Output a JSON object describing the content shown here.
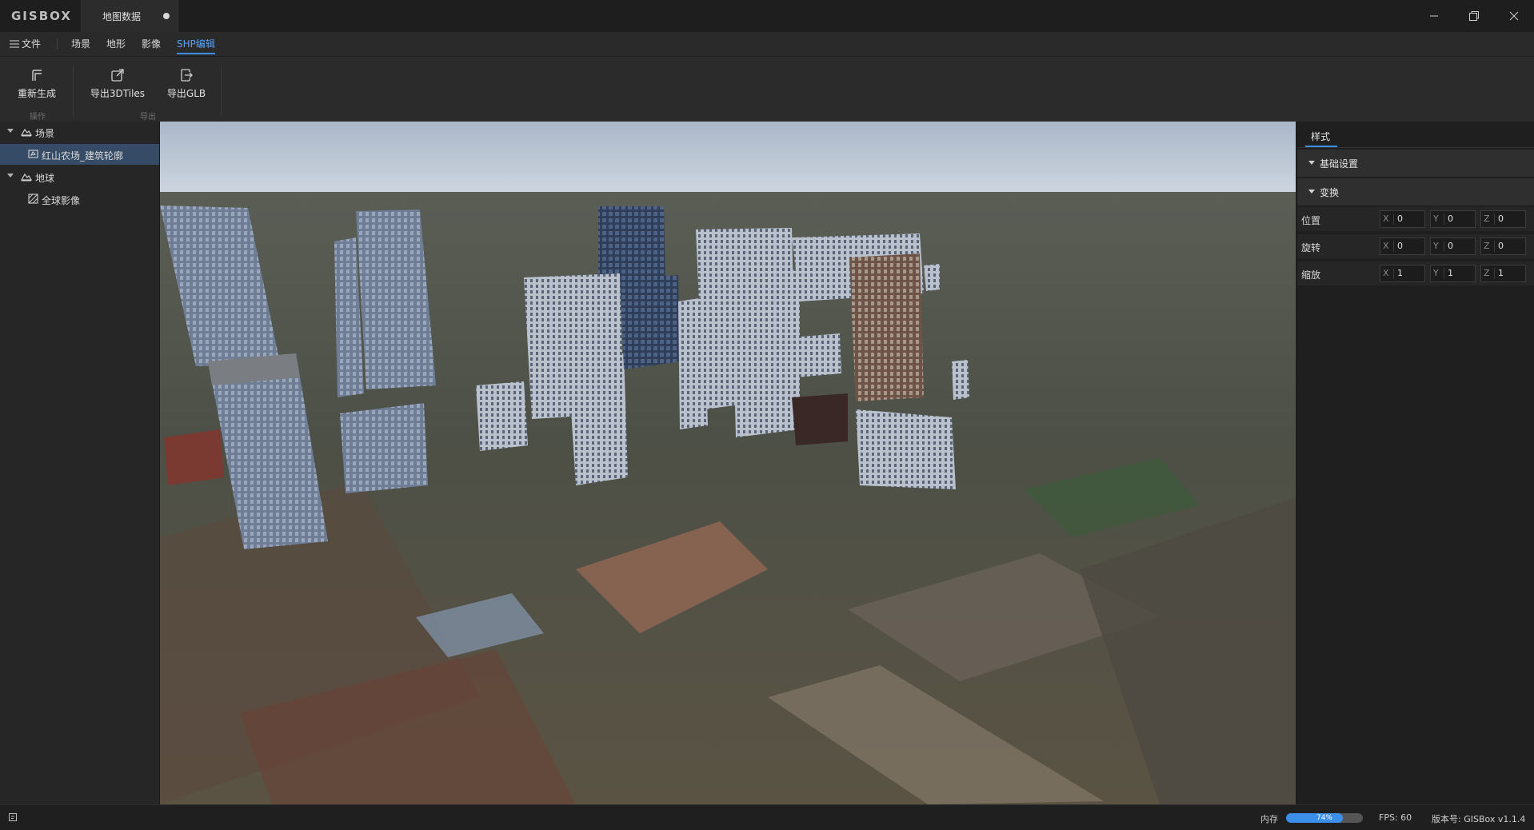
{
  "app": {
    "logo": "GISBOX"
  },
  "document_tab": {
    "title": "地图数据"
  },
  "menubar": {
    "file": "文件",
    "items": [
      {
        "label": "场景"
      },
      {
        "label": "地形"
      },
      {
        "label": "影像"
      },
      {
        "label": "SHP编辑",
        "active": true
      }
    ]
  },
  "ribbon": {
    "regenerate": "重新生成",
    "export_3dtiles": "导出3DTiles",
    "export_glb": "导出GLB",
    "group_ops": "操作",
    "group_export": "导出"
  },
  "tree": {
    "scene_label": "场景",
    "scene_child": "红山农场_建筑轮廓",
    "globe_label": "地球",
    "globe_child": "全球影像"
  },
  "panel": {
    "tab": "样式",
    "basic_settings": "基础设置",
    "transform": "变换",
    "rows": [
      {
        "label": "位置",
        "x": "0",
        "y": "0",
        "z": "0"
      },
      {
        "label": "旋转",
        "x": "0",
        "y": "0",
        "z": "0"
      },
      {
        "label": "缩放",
        "x": "1",
        "y": "1",
        "z": "1"
      }
    ],
    "axis": {
      "x": "X",
      "y": "Y",
      "z": "Z"
    }
  },
  "status": {
    "memory_label": "内存",
    "memory_percent": "74%",
    "memory_fraction": 0.74,
    "fps": "FPS: 60",
    "version": "版本号: GISBox v1.1.4"
  },
  "colors": {
    "accent": "#3b8eea",
    "selected_row": "#364c66"
  }
}
